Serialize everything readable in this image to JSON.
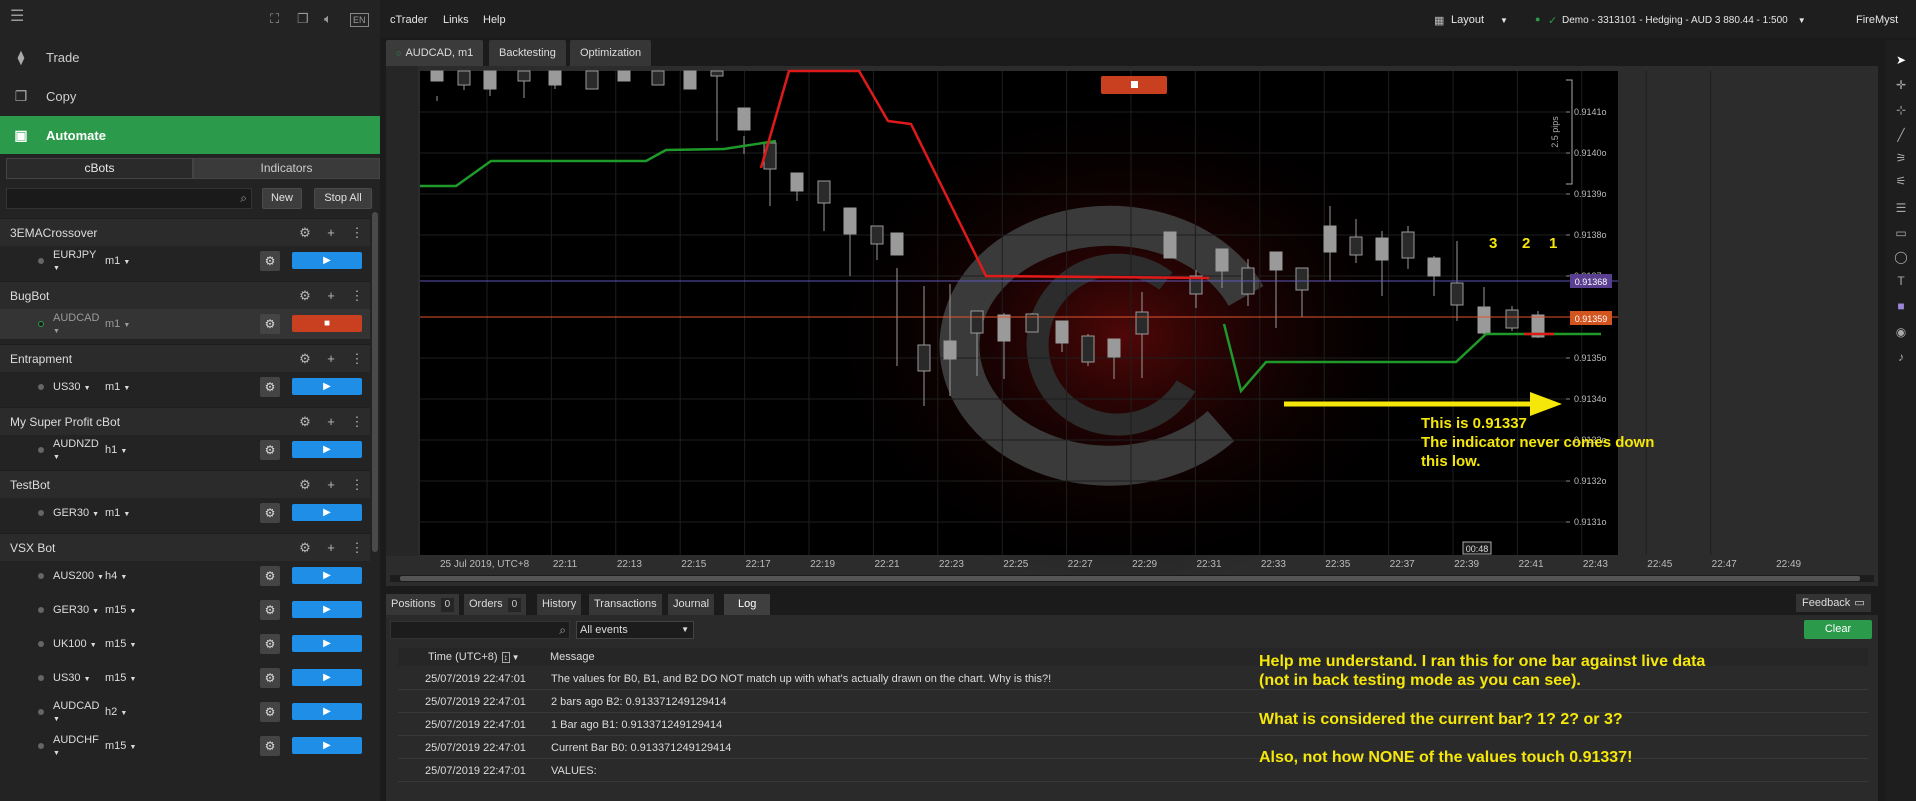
{
  "sidebar": {
    "nav": [
      {
        "label": "Trade",
        "icon": "candles-icon"
      },
      {
        "label": "Copy",
        "icon": "copy-icon"
      },
      {
        "label": "Automate",
        "icon": "robot-icon"
      }
    ],
    "subtabs": [
      "cBots",
      "Indicators"
    ],
    "new_label": "New",
    "stop_all_label": "Stop All",
    "groups": [
      {
        "name": "3EMACrossover",
        "instances": [
          {
            "symbol": "EURJPY",
            "tf": "m1",
            "running": false
          }
        ]
      },
      {
        "name": "BugBot",
        "instances": [
          {
            "symbol": "AUDCAD",
            "tf": "m1",
            "running": true
          }
        ]
      },
      {
        "name": "Entrapment",
        "instances": [
          {
            "symbol": "US30",
            "tf": "m1",
            "running": false
          }
        ]
      },
      {
        "name": "My Super Profit cBot",
        "instances": [
          {
            "symbol": "AUDNZD",
            "tf": "h1",
            "running": false
          }
        ]
      },
      {
        "name": "TestBot",
        "instances": [
          {
            "symbol": "GER30",
            "tf": "m1",
            "running": false
          }
        ]
      },
      {
        "name": "VSX Bot",
        "instances": [
          {
            "symbol": "AUS200",
            "tf": "h4",
            "running": false
          },
          {
            "symbol": "GER30",
            "tf": "m15",
            "running": false
          },
          {
            "symbol": "UK100",
            "tf": "m15",
            "running": false
          },
          {
            "symbol": "US30",
            "tf": "m15",
            "running": false
          },
          {
            "symbol": "AUDCAD",
            "tf": "h2",
            "running": false
          },
          {
            "symbol": "AUDCHF",
            "tf": "m15",
            "running": false
          }
        ]
      }
    ],
    "lang": "EN"
  },
  "topbar": {
    "menus": [
      "cTrader",
      "Links",
      "Help"
    ],
    "layout_label": "Layout",
    "account": "Demo - 3313101 - Hedging - AUD 3 880.44 - 1:500",
    "user": "FireMyst"
  },
  "chart_tabs": [
    "AUDCAD, m1",
    "Backtesting",
    "Optimization"
  ],
  "chart": {
    "date_label": "25 Jul 2019, UTC+8",
    "x_ticks": [
      "22:11",
      "22:13",
      "22:15",
      "22:17",
      "22:19",
      "22:21",
      "22:23",
      "22:25",
      "22:27",
      "22:29",
      "22:31",
      "22:33",
      "22:35",
      "22:37",
      "22:39",
      "22:41",
      "22:43",
      "22:45",
      "22:47",
      "22:49"
    ],
    "y_ticks": [
      "0.9141o",
      "0.9140o",
      "0.9139o",
      "0.9138o",
      "0.9137o",
      "0.9136o",
      "0.9135o",
      "0.9134o",
      "0.9133o",
      "0.9132o",
      "0.9131o"
    ],
    "price_tag_purple": "0.91368",
    "price_tag_orange": "0.91359",
    "cursor_time": "00:48",
    "pips_label": "2.5 pips",
    "bar_numbers": [
      "3",
      "2",
      "1"
    ],
    "stop_icon": "stop-square-icon",
    "annotation_lines": [
      "This is 0.91337",
      "The indicator never comes down",
      "this low."
    ]
  },
  "bottom_tabs": [
    {
      "label": "Positions",
      "count": "0"
    },
    {
      "label": "Orders",
      "count": "0"
    },
    {
      "label": "History",
      "count": ""
    },
    {
      "label": "Transactions",
      "count": ""
    },
    {
      "label": "Journal",
      "count": ""
    },
    {
      "label": "Log",
      "count": ""
    }
  ],
  "feedback_label": "Feedback",
  "log": {
    "filter": "All events",
    "clear_label": "Clear",
    "col_time": "Time (UTC+8)",
    "col_message": "Message",
    "rows": [
      {
        "time": "25/07/2019 22:47:01",
        "message": "The values for B0, B1, and B2 DO NOT match up with what's actually drawn on the chart. Why is this?!"
      },
      {
        "time": "25/07/2019 22:47:01",
        "message": "2 bars ago B2: 0.913371249129414"
      },
      {
        "time": "25/07/2019 22:47:01",
        "message": "1 Bar ago B1: 0.913371249129414"
      },
      {
        "time": "25/07/2019 22:47:01",
        "message": "Current Bar B0: 0.913371249129414"
      },
      {
        "time": "25/07/2019 22:47:01",
        "message": "VALUES:"
      }
    ]
  },
  "notes": [
    "Help me understand. I ran this for one bar against live data",
    "(not in back testing mode as you can see).",
    "What is considered the current bar? 1? 2? or 3?",
    "Also, not how NONE of the values touch 0.91337!"
  ]
}
